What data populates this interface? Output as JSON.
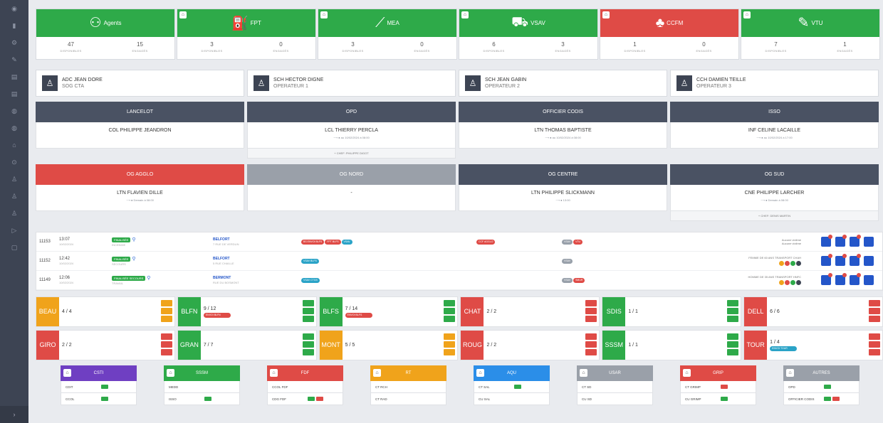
{
  "sidebar": {
    "icons": [
      "dashboard-icon",
      "chart-icon",
      "settings-icon",
      "edit-icon",
      "list-icon",
      "list-icon-2",
      "globe-icon",
      "globe-icon-2",
      "map-icon",
      "location-icon",
      "user-icon",
      "user-group-icon",
      "user-icon-2",
      "play-icon",
      "document-icon"
    ],
    "expand": "›"
  },
  "resources": [
    {
      "name": "Agents",
      "icon": "agents-icon",
      "glyph": "⚇",
      "color": "green",
      "home": false,
      "dispo": "47",
      "engages": "15",
      "dispo_label": "DISPONIBLES",
      "eng_label": "ENGAGÉS"
    },
    {
      "name": "FPT",
      "icon": "fire-hose-icon",
      "glyph": "⛽",
      "color": "green",
      "home": true,
      "dispo": "3",
      "engages": "0",
      "dispo_label": "DISPONIBLES",
      "eng_label": "ENGAGÉS"
    },
    {
      "name": "MEA",
      "icon": "ladder-icon",
      "glyph": "⟋",
      "color": "green",
      "home": true,
      "dispo": "3",
      "engages": "0",
      "dispo_label": "DISPONIBLES",
      "eng_label": "ENGAGÉS"
    },
    {
      "name": "VSAV",
      "icon": "ambulance-icon",
      "glyph": "⛟",
      "color": "green",
      "home": true,
      "dispo": "6",
      "engages": "3",
      "dispo_label": "DISPONIBLES",
      "eng_label": "ENGAGÉS"
    },
    {
      "name": "CCFM",
      "icon": "tree-icon",
      "glyph": "♣",
      "color": "red",
      "home": true,
      "dispo": "1",
      "engages": "0",
      "dispo_label": "DISPONIBLES",
      "eng_label": "ENGAGÉS"
    },
    {
      "name": "VTU",
      "icon": "wrench-icon",
      "glyph": "✎",
      "color": "green",
      "home": true,
      "dispo": "7",
      "engages": "1",
      "dispo_label": "DISPONIBLES",
      "eng_label": "ENGAGÉS"
    }
  ],
  "operators": [
    {
      "name": "ADC JEAN DORE",
      "role": "SOG CTA"
    },
    {
      "name": "SCH HECTOR DIGNE",
      "role": "OPERATEUR 1"
    },
    {
      "name": "SCH JEAN GABIN",
      "role": "OPERATEUR 2"
    },
    {
      "name": "CCH DAMIEN TEILLE",
      "role": "OPERATEUR 3"
    }
  ],
  "officers": [
    {
      "title": "LANCELOT",
      "name": "COL PHILIPPE JEANDRON",
      "sub": "",
      "footer": ""
    },
    {
      "title": "OPD",
      "name": "LCL THIERRY PERCLA",
      "sub": "⟶ ● au 10/02/2024 à 08:00",
      "footer": "+ CHEF: PHILIPPE DIGOT"
    },
    {
      "title": "OFFICIER CODIS",
      "name": "LTN THOMAS BAPTISTE",
      "sub": "⟶ ● au 10/02/2024 à 08:00",
      "footer": ""
    },
    {
      "title": "ISSO",
      "name": "INF CELINE LACAILLE",
      "sub": "⟶ ● au 10/02/2024 à 17:00",
      "footer": ""
    }
  ],
  "groups": [
    {
      "title": "OG AGGLO",
      "color": "red",
      "name": "LTN FLAVIEN DILLE",
      "sub": "⟶ ● Demain à 08:00",
      "footer": ""
    },
    {
      "title": "OG NORD",
      "color": "gray",
      "name": "-",
      "sub": "",
      "footer": ""
    },
    {
      "title": "OG CENTRE",
      "color": "dark",
      "name": "LTN PHILIPPE SLICKMANN",
      "sub": "⟶ ● 13:00",
      "footer": ""
    },
    {
      "title": "OG SUD",
      "color": "dark",
      "name": "CNE PHILIPPE LARCHER",
      "sub": "⟶ ● Demain à 08:00",
      "footer": "+ CHEF: DENIS MARTIN"
    }
  ],
  "interventions": [
    {
      "num": "11153",
      "time": "13:07",
      "date": "10/02/2024",
      "status": "FINALISÉE",
      "nature": "INCENDIE",
      "ville": "BELFORT",
      "adresse": "7 RUE DE VERDUN",
      "vehicles": [
        "BS ENVOI BLFS",
        "FPT BLFS",
        "VSAV"
      ],
      "eng2": "CCF AGGLO",
      "eng3": [
        "VSAV",
        "VTU"
      ],
      "desc": "Aucune victime",
      "desc2": "Aucune victime"
    },
    {
      "num": "11152",
      "time": "12:42",
      "date": "10/02/2024",
      "status": "FINALISÉE",
      "nature": "SECOURS",
      "ville": "BELFORT",
      "adresse": "5 RUE CHAILLE",
      "vehicles": [
        "VSAV BLFS"
      ],
      "eng2": "",
      "eng3": [
        "VSAV"
      ],
      "desc": "FEMME DE 60 ANS TRANSPORT CHAH",
      "desc2": ""
    },
    {
      "num": "11149",
      "time": "12:06",
      "date": "10/02/2024",
      "status": "FINALISÉE SECOURS",
      "nature": "TRAVAIL",
      "ville": "BERMONT",
      "adresse": "RUE DU BOSMONT",
      "vehicles": [
        "VSAV CTGS"
      ],
      "eng2": "",
      "eng3": [
        "VSAV",
        "SMUR"
      ],
      "desc": "HOMME DE 35 ANS TRANSPORT HNFC",
      "desc2": ""
    }
  ],
  "centres_row1": [
    {
      "code": "BEAU",
      "color": "o",
      "count": "4 / 4",
      "tag": ""
    },
    {
      "code": "BLFN",
      "color": "gr",
      "count": "9 / 12",
      "tag": "ENVOI BLFN"
    },
    {
      "code": "BLFS",
      "color": "gr",
      "count": "7 / 14",
      "tag": "ENVOI BLFS"
    },
    {
      "code": "CHAT",
      "color": "rd",
      "count": "2 / 2",
      "tag": ""
    },
    {
      "code": "SDIS",
      "color": "gr",
      "count": "1 / 1",
      "tag": ""
    },
    {
      "code": "DELL",
      "color": "rd",
      "count": "6 / 6",
      "tag": ""
    }
  ],
  "centres_row2": [
    {
      "code": "GIRO",
      "color": "rd",
      "count": "2 / 2",
      "tag": ""
    },
    {
      "code": "GRAN",
      "color": "gr",
      "count": "7 / 7",
      "tag": ""
    },
    {
      "code": "MONT",
      "color": "o",
      "count": "5 / 5",
      "tag": ""
    },
    {
      "code": "ROUG",
      "color": "rd",
      "count": "2 / 2",
      "tag": ""
    },
    {
      "code": "SSSM",
      "color": "gr",
      "count": "1 / 1",
      "tag": ""
    },
    {
      "code": "TOUR",
      "color": "rd",
      "count": "1 / 4",
      "tag": "ENVOI TOUR"
    }
  ],
  "tables": [
    {
      "title": "CSTI",
      "color": "#6f3fc2",
      "rows": [
        {
          "l": "CDIT",
          "b": [
            "gr"
          ]
        },
        {
          "l": "CCOL",
          "b": [
            "gr"
          ]
        }
      ]
    },
    {
      "title": "SSSM",
      "color": "#2eaa49",
      "rows": [
        {
          "l": "MEDD",
          "b": []
        },
        {
          "l": "ISSO",
          "b": [
            "gr"
          ]
        }
      ]
    },
    {
      "title": "FDF",
      "color": "#df4b46",
      "rows": [
        {
          "l": "CCOL FDF",
          "b": []
        },
        {
          "l": "CDG FDF",
          "b": [
            "gr",
            "rd"
          ]
        }
      ]
    },
    {
      "title": "RT",
      "color": "#f0a31b",
      "rows": [
        {
          "l": "CT RCH",
          "b": []
        },
        {
          "l": "CT RAD",
          "b": []
        }
      ]
    },
    {
      "title": "AQU",
      "color": "#2b8ee8",
      "rows": [
        {
          "l": "CT SAL",
          "b": [
            "gr"
          ]
        },
        {
          "l": "CU SAL",
          "b": []
        }
      ]
    },
    {
      "title": "USAR",
      "color": "#9aa0a9",
      "rows": [
        {
          "l": "CT SD",
          "b": []
        },
        {
          "l": "CU SD",
          "b": []
        }
      ]
    },
    {
      "title": "GRIP",
      "color": "#df4b46",
      "rows": [
        {
          "l": "CT GRIMP",
          "b": [
            "rd"
          ]
        },
        {
          "l": "CU GRIMP",
          "b": [
            "gr"
          ]
        }
      ]
    },
    {
      "title": "AUTRES",
      "color": "#9aa0a9",
      "rows": [
        {
          "l": "OPD",
          "b": [
            "gr"
          ]
        },
        {
          "l": "OFFICIER CODIS",
          "b": [
            "gr",
            "rd"
          ]
        }
      ]
    }
  ]
}
